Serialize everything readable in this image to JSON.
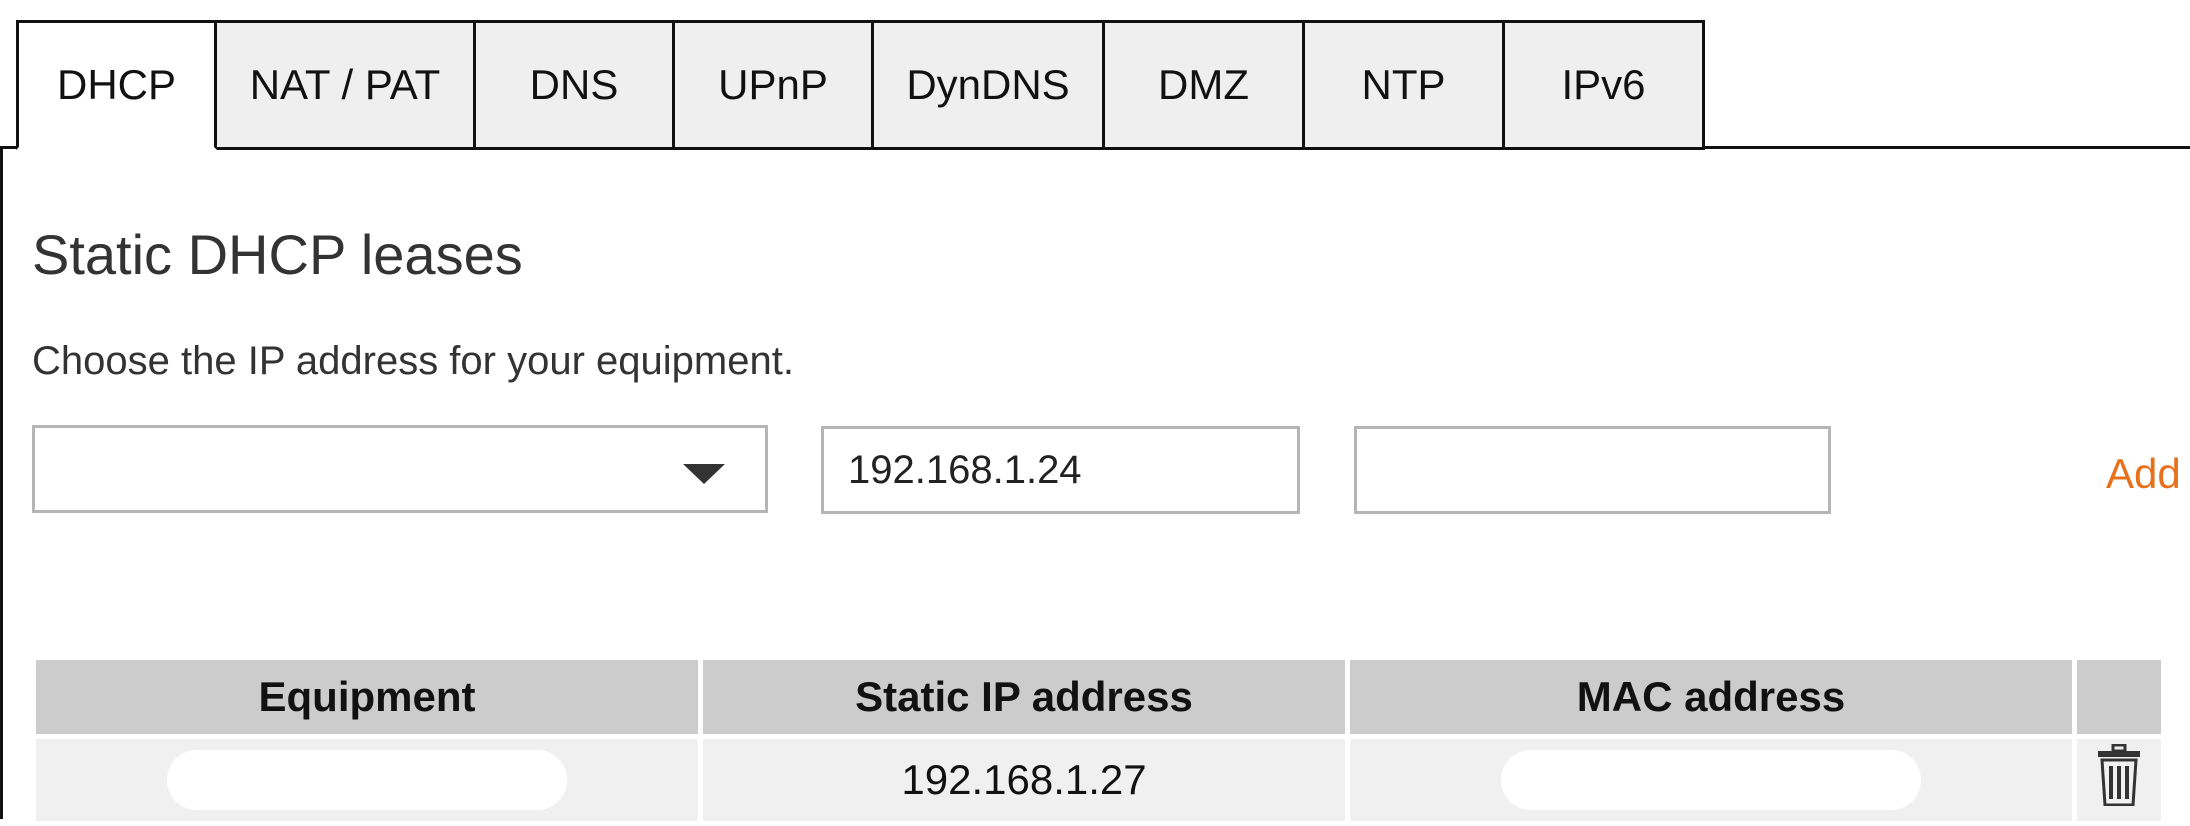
{
  "tabs": [
    {
      "label": "DHCP",
      "active": true
    },
    {
      "label": "NAT / PAT",
      "active": false
    },
    {
      "label": "DNS",
      "active": false
    },
    {
      "label": "UPnP",
      "active": false
    },
    {
      "label": "DynDNS",
      "active": false
    },
    {
      "label": "DMZ",
      "active": false
    },
    {
      "label": "NTP",
      "active": false
    },
    {
      "label": "IPv6",
      "active": false
    }
  ],
  "section": {
    "title": "Static DHCP leases",
    "description": "Choose the IP address for your equipment."
  },
  "form": {
    "equipment_select_value": "",
    "ip_value": "192.168.1.24",
    "mac_value": "",
    "add_label": "Add"
  },
  "table": {
    "headers": {
      "equipment": "Equipment",
      "static_ip": "Static IP address",
      "mac": "MAC address"
    },
    "rows": [
      {
        "equipment": "",
        "static_ip": "192.168.1.27",
        "mac": ""
      }
    ]
  },
  "colors": {
    "accent": "#e8701a",
    "header_bg": "#cccccc",
    "row_bg": "#f0f0f0",
    "tab_bg": "#efefef"
  },
  "icons": {
    "delete": "trash-icon",
    "select": "chevron-down-icon"
  }
}
